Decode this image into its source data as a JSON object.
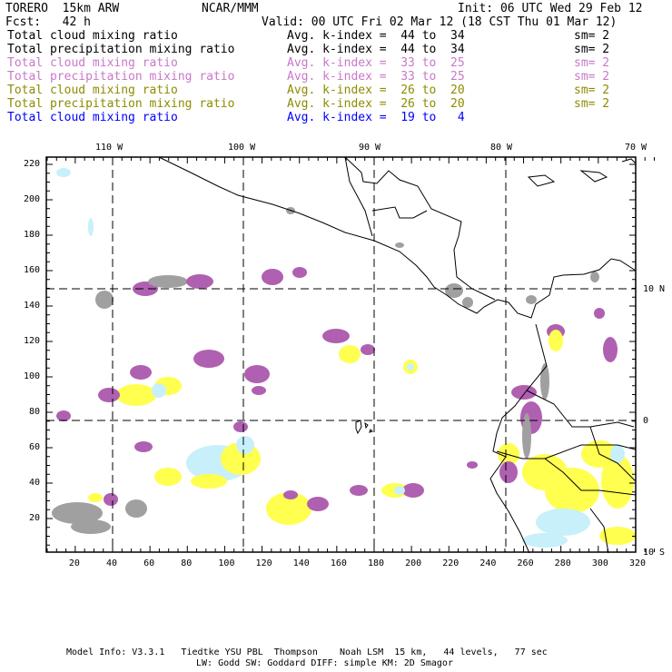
{
  "header": {
    "model": "TORERO  15km ARW",
    "org": "NCAR/MMM",
    "init": "Init: 06 UTC Wed 29 Feb 12",
    "fcst": "Fcst:   42 h",
    "valid": "Valid: 00 UTC Fri 02 Mar 12 (18 CST Thu 01 Mar 12)"
  },
  "legend": [
    {
      "field": "Total cloud mixing ratio",
      "range": "Avg. k-index =  44 to  34",
      "sm": "sm= 2",
      "color": "#000000"
    },
    {
      "field": "Total precipitation mixing ratio",
      "range": "Avg. k-index =  44 to  34",
      "sm": "sm= 2",
      "color": "#000000"
    },
    {
      "field": "Total cloud mixing ratio",
      "range": "Avg. k-index =  33 to  25",
      "sm": "sm= 2",
      "color": "#c878c8"
    },
    {
      "field": "Total precipitation mixing ratio",
      "range": "Avg. k-index =  33 to  25",
      "sm": "sm= 2",
      "color": "#c878c8"
    },
    {
      "field": "Total cloud mixing ratio",
      "range": "Avg. k-index =  26 to  20",
      "sm": "sm= 2",
      "color": "#8c8c00"
    },
    {
      "field": "Total precipitation mixing ratio",
      "range": "Avg. k-index =  26 to  20",
      "sm": "sm= 2",
      "color": "#8c8c00"
    },
    {
      "field": "Total cloud mixing ratio",
      "range": "Avg. k-index =  19 to   4",
      "sm": "",
      "color": "#0000ff"
    }
  ],
  "map": {
    "lon_labels": [
      "110 W",
      "100 W",
      "90 W",
      "80 W",
      "70 W"
    ],
    "lat_labels": [
      "10 N",
      "0",
      "10 S"
    ],
    "x_ticks": [
      "20",
      "40",
      "60",
      "80",
      "100",
      "120",
      "140",
      "160",
      "180",
      "200",
      "220",
      "240",
      "260",
      "280",
      "300",
      "320"
    ],
    "y_ticks": [
      "20",
      "40",
      "60",
      "80",
      "100",
      "120",
      "140",
      "160",
      "180",
      "200",
      "220"
    ],
    "colors": {
      "gray": "#a0a0a0",
      "purple": "#b060b0",
      "yellow": "#ffff50",
      "cyan": "#c8f0fa"
    }
  },
  "footer": {
    "line1": "Model Info: V3.3.1   Tiedtke YSU PBL  Thompson    Noah LSM  15 km,   44 levels,   77 sec",
    "line2": "LW: Godd SW: Goddard DIFF: simple KM: 2D Smagor"
  }
}
